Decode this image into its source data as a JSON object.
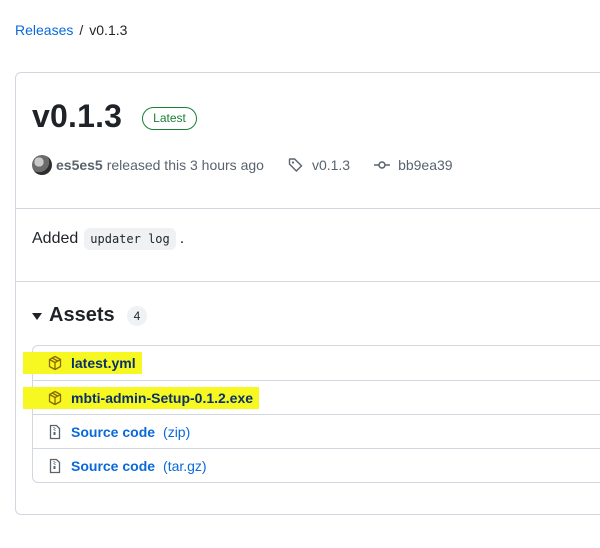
{
  "breadcrumb": {
    "releases": "Releases",
    "separator": "/",
    "current": "v0.1.3"
  },
  "release": {
    "title": "v0.1.3",
    "badge": "Latest",
    "author": "es5es5",
    "released_text": "released this 3 hours ago",
    "tag": "v0.1.3",
    "commit": "bb9ea39",
    "body": {
      "prefix": "Added",
      "code": "updater log",
      "suffix": "."
    }
  },
  "assets": {
    "title": "Assets",
    "count": "4",
    "items": [
      {
        "name": "latest.yml",
        "suffix": "",
        "icon": "package-icon",
        "highlighted": true
      },
      {
        "name": "mbti-admin-Setup-0.1.2.exe",
        "suffix": "",
        "icon": "package-icon",
        "highlighted": true
      },
      {
        "name": "Source code",
        "suffix": "(zip)",
        "icon": "file-zip-icon",
        "highlighted": false
      },
      {
        "name": "Source code",
        "suffix": "(tar.gz)",
        "icon": "file-zip-icon",
        "highlighted": false
      }
    ]
  },
  "colors": {
    "link": "#0969da",
    "highlight": "#f7f722",
    "badge_green": "#1a7f37",
    "border": "#d0d7de"
  }
}
